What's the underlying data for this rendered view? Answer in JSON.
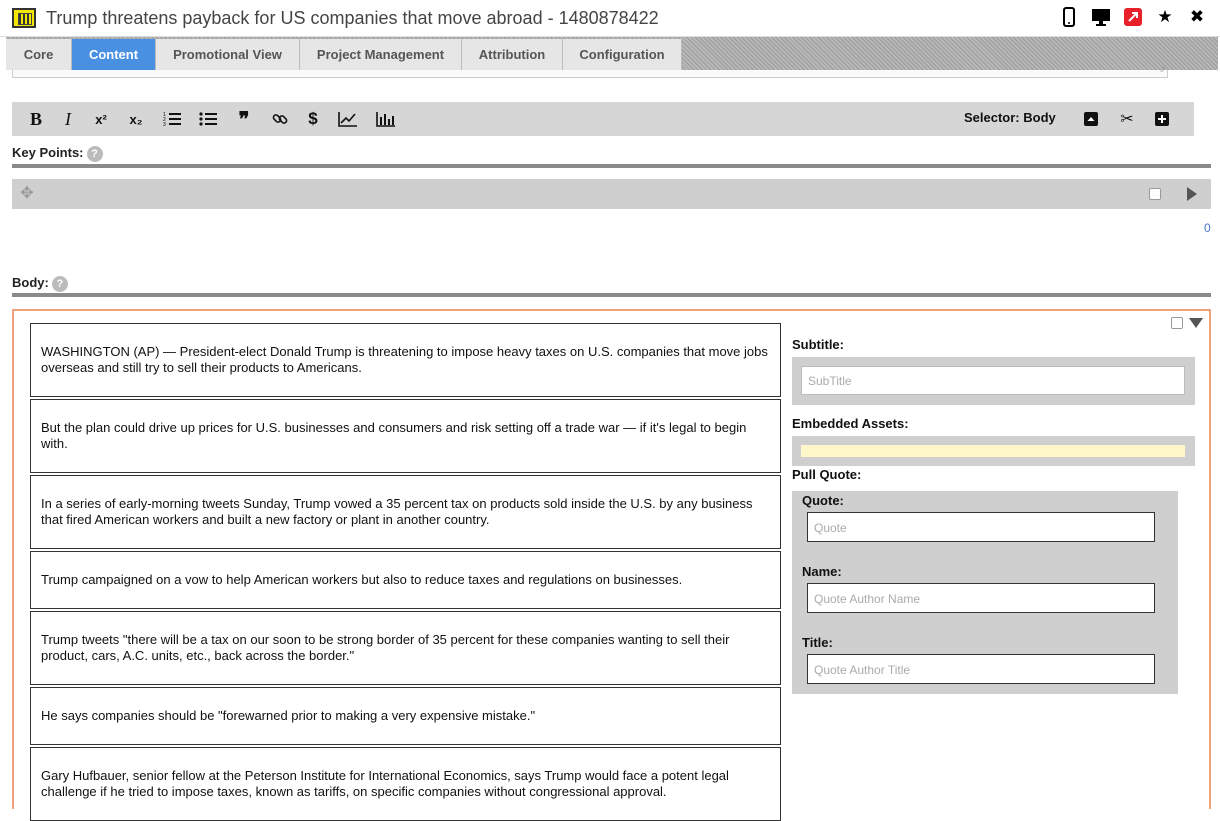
{
  "window": {
    "title": "Trump threatens payback for US companies that move abroad - 1480878422",
    "actions": [
      "mobile-icon",
      "desktop-icon",
      "external-link-icon",
      "star-icon",
      "close-icon"
    ]
  },
  "tabs": [
    {
      "label": "Core"
    },
    {
      "label": "Content",
      "active": true
    },
    {
      "label": "Promotional View"
    },
    {
      "label": "Project Management"
    },
    {
      "label": "Attribution"
    },
    {
      "label": "Configuration"
    }
  ],
  "toolbar": {
    "bold": "B",
    "italic": "I",
    "superscript": "x²",
    "subscript": "x₂",
    "quote": "❞",
    "dollar": "$",
    "selector_label": "Selector: Body"
  },
  "key_points": {
    "label": "Key Points:",
    "count": "0"
  },
  "body": {
    "label": "Body:",
    "paragraphs": [
      "WASHINGTON (AP) — President-elect Donald Trump is threatening to impose heavy taxes on U.S. companies that move jobs overseas and still try to sell their products to Americans.",
      "But the plan could drive up prices for U.S. businesses and consumers and risk setting off a trade war — if it's legal to begin with.",
      "In a series of early-morning tweets Sunday, Trump vowed a 35 percent tax on products sold inside the U.S. by any business that fired American workers and built a new factory or plant in another country.",
      "Trump campaigned on a vow to help American workers but also to reduce taxes and regulations on businesses.",
      "Trump tweets \"there will be a tax on our soon to be strong border of 35 percent for these companies wanting to sell their product, cars, A.C. units, etc., back across the border.\"",
      "He says companies should be \"forewarned prior to making a very expensive mistake.\"",
      "Gary Hufbauer, senior fellow at the Peterson Institute for International Economics, says Trump would face a potent legal challenge if he tried to impose taxes, known as tariffs, on specific companies without congressional approval."
    ]
  },
  "sidebar": {
    "subtitle_label": "Subtitle:",
    "subtitle_placeholder": "SubTitle",
    "embedded_label": "Embedded Assets:",
    "pull_quote_label": "Pull Quote:",
    "quote_label": "Quote:",
    "quote_placeholder": "Quote",
    "name_label": "Name:",
    "name_placeholder": "Quote Author Name",
    "title_label": "Title:",
    "title_placeholder": "Quote Author Title"
  }
}
